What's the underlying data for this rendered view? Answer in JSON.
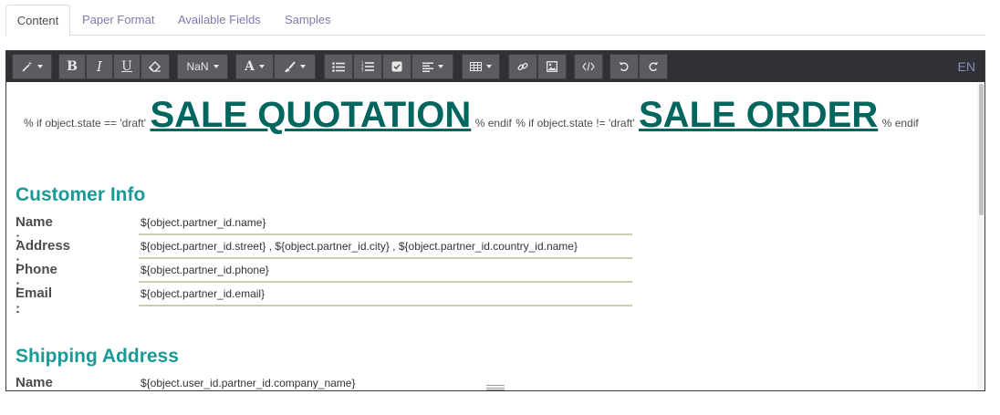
{
  "tabs": [
    {
      "label": "Content",
      "active": true
    },
    {
      "label": "Paper Format",
      "active": false
    },
    {
      "label": "Available Fields",
      "active": false
    },
    {
      "label": "Samples",
      "active": false
    }
  ],
  "toolbar": {
    "font_size_value": "NaN",
    "language": "EN"
  },
  "header": {
    "if_draft": "% if object.state == 'draft'",
    "quotation_title": "SALE QUOTATION",
    "endif_1": "% endif",
    "if_not_draft": "% if object.state != 'draft'",
    "order_title": "SALE ORDER",
    "endif_2": "% endif"
  },
  "customer_info": {
    "title": "Customer Info",
    "rows": [
      {
        "label": "Name :",
        "value": "${object.partner_id.name}"
      },
      {
        "label": "Address :",
        "value": "${object.partner_id.street} , ${object.partner_id.city} , ${object.partner_id.country_id.name}"
      },
      {
        "label": "Phone :",
        "value": "${object.partner_id.phone}"
      },
      {
        "label": "Email :",
        "value": "${object.partner_id.email}"
      }
    ]
  },
  "shipping_address": {
    "title": "Shipping Address",
    "rows": [
      {
        "label": "Name :",
        "value": "${object.user_id.partner_id.company_name}"
      }
    ]
  },
  "colors": {
    "title_color": "#00665e",
    "section_color": "#1a9a96",
    "toolbar_bg": "#2f3136"
  }
}
